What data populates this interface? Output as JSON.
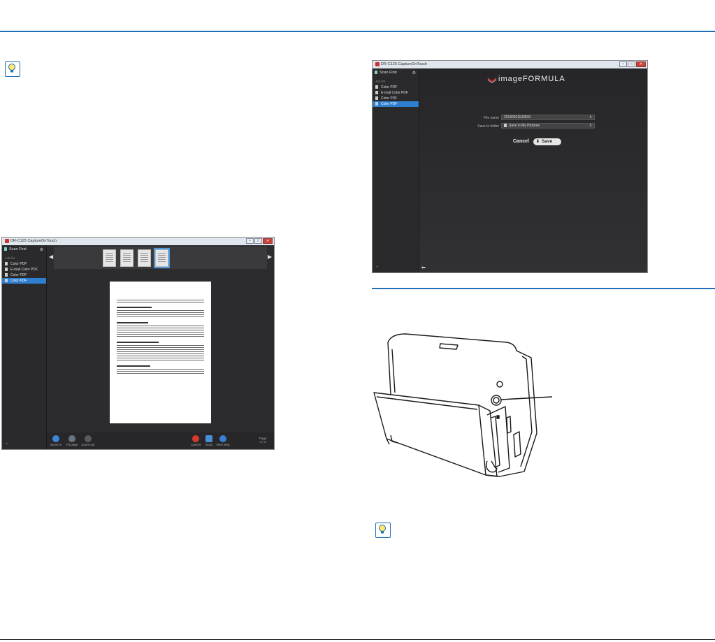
{
  "left_screenshot": {
    "window_title": "DR-C125 CaptureOnTouch",
    "sidebar": {
      "header": "Scan First",
      "section_label": "Job list",
      "items": [
        "Color PDF",
        "E-mail Color PDF",
        "Color PDF",
        "Color PDF"
      ],
      "selected_index": 3
    },
    "toolbar": {
      "left_buttons": [
        "Zoom in",
        "Fit page",
        "Zoom out"
      ],
      "right_buttons": [
        "Cancel",
        "Scan",
        "Next step"
      ],
      "page_label": "Page",
      "page_value": "4 / 4"
    },
    "thumbnail_count": 4
  },
  "right_screenshot": {
    "window_title": "DR-C125 CaptureOnTouch",
    "sidebar": {
      "header": "Scan First",
      "section_label": "Job list",
      "items": [
        "Color PDF",
        "E-mail Color PDF",
        "Color PDF",
        "Color PDF"
      ],
      "selected_index": 3
    },
    "logo": "imageFORMULA",
    "form": {
      "file_name_label": "File name",
      "file_name_value": "20150911133810",
      "save_to_label": "Save to folder",
      "save_to_value": "Save in My Pictures",
      "cancel_label": "Cancel",
      "save_label": "Save"
    }
  },
  "colors": {
    "accent_blue": "#1f6fb8",
    "selection_blue": "#2f7fd1",
    "app_background": "#2c2c2e"
  },
  "icons": {
    "hint_icon": "lightbulb-icon",
    "close_window": "close-icon",
    "settings": "gear-icon"
  }
}
